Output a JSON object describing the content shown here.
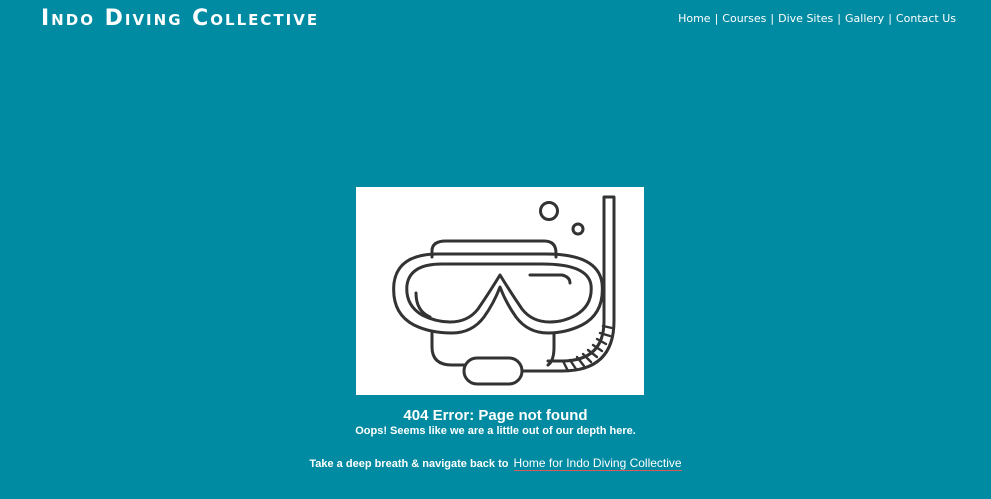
{
  "header": {
    "brand": "Indo Diving Collective"
  },
  "nav": {
    "items": [
      {
        "label": "Home"
      },
      {
        "label": "Courses"
      },
      {
        "label": "Dive Sites"
      },
      {
        "label": "Gallery"
      },
      {
        "label": "Contact Us"
      }
    ],
    "separator": "|"
  },
  "error": {
    "image_icon": "snorkel-mask-icon",
    "title": "404 Error: Page not found",
    "subtitle": "Oops! Seems like we are a little out of our depth here.",
    "back_text": "Take a deep breath & navigate back to",
    "back_link": "Home for Indo Diving Collective"
  },
  "colors": {
    "background": "#008ba3",
    "text": "#ffffff",
    "link_underline": "#d65a5a",
    "icon_stroke": "#333333"
  }
}
